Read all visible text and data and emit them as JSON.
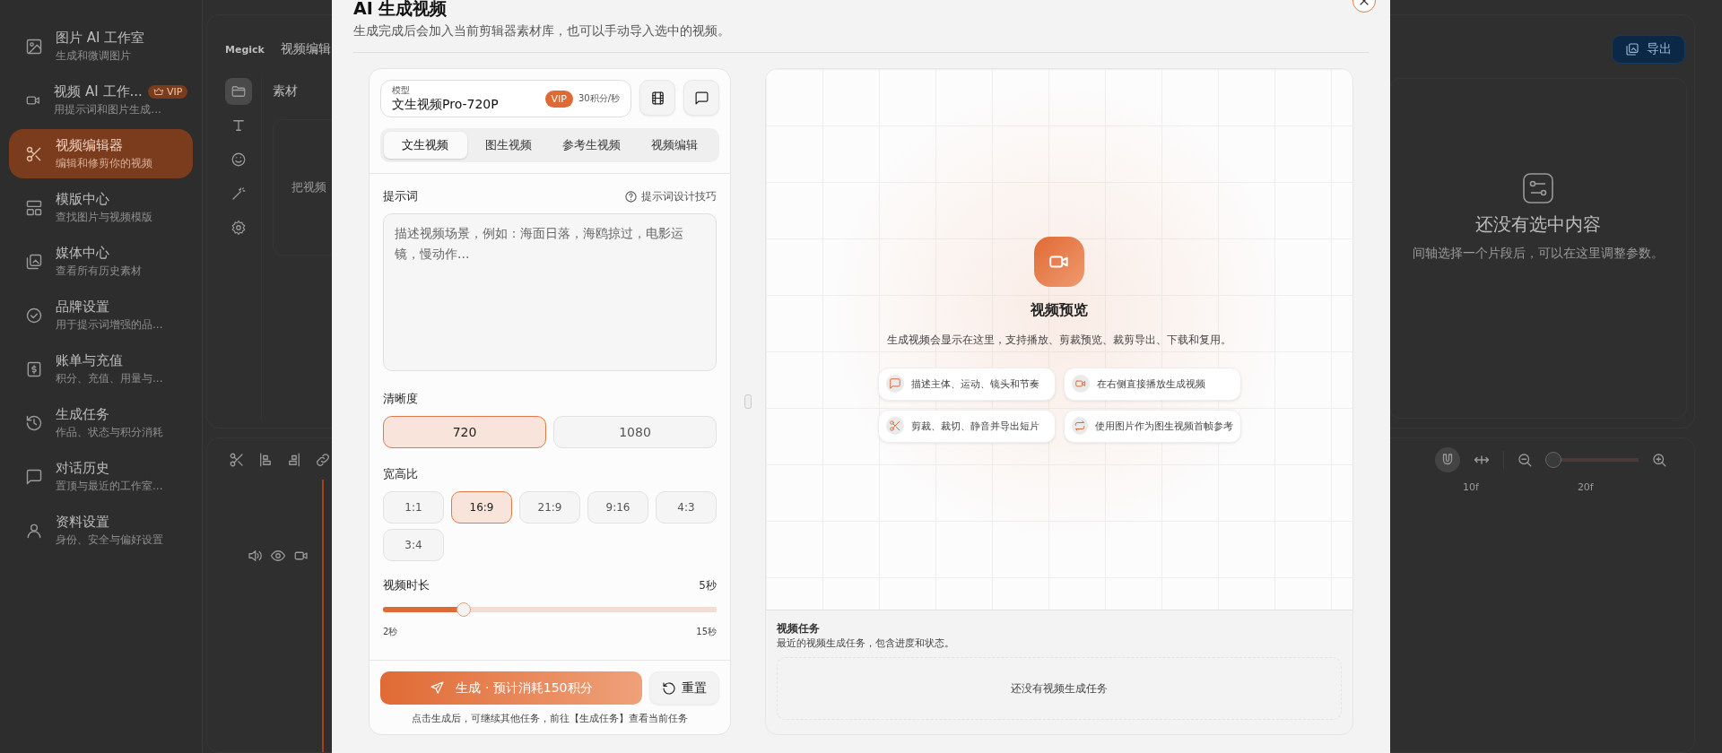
{
  "sidebar": {
    "items": [
      {
        "title": "图片 AI 工作室",
        "subtitle": "生成和微调图片",
        "selected": false
      },
      {
        "title": "视频 AI 工作...",
        "subtitle": "用提示词和图片生成...",
        "selected": false,
        "badge": "VIP"
      },
      {
        "title": "视频编辑器",
        "subtitle": "编辑和修剪你的视频",
        "selected": true
      },
      {
        "title": "模版中心",
        "subtitle": "查找图片与视频模版",
        "selected": false
      },
      {
        "title": "媒体中心",
        "subtitle": "查看所有历史素材",
        "selected": false
      },
      {
        "title": "品牌设置",
        "subtitle": "用于提示词增强的品...",
        "selected": false
      },
      {
        "title": "账单与充值",
        "subtitle": "积分、充值、用量与...",
        "selected": false
      },
      {
        "title": "生成任务",
        "subtitle": "作品、状态与积分消耗",
        "selected": false
      },
      {
        "title": "对话历史",
        "subtitle": "置顶与最近的工作室...",
        "selected": false
      },
      {
        "title": "资料设置",
        "subtitle": "身份、安全与偏好设置",
        "selected": false
      }
    ]
  },
  "editor": {
    "logo": "Megick",
    "title": "视频编辑",
    "export_button": "导出",
    "tool_rail": [
      {
        "kind": "folder",
        "selected": true
      },
      {
        "kind": "text",
        "selected": false
      },
      {
        "kind": "emoji",
        "selected": false
      },
      {
        "kind": "wand",
        "selected": false
      },
      {
        "kind": "gear",
        "selected": false
      }
    ],
    "materials": {
      "title": "素材",
      "drop_hint": "把视频"
    },
    "inspector": {
      "title": "还没有选中内容",
      "hint": "间轴选择一个片段后，可以在这里调整参数。"
    },
    "timeline": {
      "ruler_labels": [
        "10f",
        "20f"
      ],
      "zoom": {
        "level": 0
      }
    }
  },
  "modal": {
    "title": "AI 生成视频",
    "subtitle": "生成完成后会加入当前剪辑器素材库，也可以手动导入选中的视频。",
    "model": {
      "label": "模型",
      "value": "文生视频Pro-720P",
      "badge": "VIP",
      "price": "30积分/秒"
    },
    "tabs": [
      {
        "label": "文生视频",
        "selected": true
      },
      {
        "label": "图生视频",
        "selected": false
      },
      {
        "label": "参考生视频",
        "selected": false
      },
      {
        "label": "视频编辑",
        "selected": false
      }
    ],
    "prompt": {
      "label": "提示词",
      "help_link": "提示词设计技巧",
      "placeholder": "描述视频场景，例如：海面日落，海鸥掠过，电影运镜，慢动作..."
    },
    "resolution": {
      "label": "清晰度",
      "options": [
        {
          "label": "720",
          "selected": true
        },
        {
          "label": "1080",
          "selected": false
        }
      ]
    },
    "aspect_ratio": {
      "label": "宽高比",
      "options": [
        {
          "label": "1:1",
          "selected": false
        },
        {
          "label": "16:9",
          "selected": true
        },
        {
          "label": "21:9",
          "selected": false
        },
        {
          "label": "9:16",
          "selected": false
        },
        {
          "label": "4:3",
          "selected": false
        },
        {
          "label": "3:4",
          "selected": false
        }
      ]
    },
    "duration": {
      "label": "视频时长",
      "value": "5秒",
      "level": 0.23,
      "min_label": "2秒",
      "max_label": "15秒"
    },
    "generate_button": "生成 · 预计消耗150积分",
    "reset_button": "重置",
    "footnote": "点击生成后，可继续其他任务，前往【生成任务】查看当前任务",
    "preview": {
      "title": "视频预览",
      "description": "生成视频会显示在这里，支持播放、剪裁预览、裁剪导出、下载和复用。",
      "tips": [
        {
          "kind": "chat",
          "text": "描述主体、运动、镜头和节奏"
        },
        {
          "kind": "video",
          "text": "在右侧直接播放生成视频"
        },
        {
          "kind": "scissors",
          "text": "剪裁、裁切、静音并导出短片"
        },
        {
          "kind": "repeat",
          "text": "使用图片作为图生视频首帧参考"
        }
      ]
    },
    "tasks": {
      "title": "视频任务",
      "subtitle": "最近的视频生成任务，包含进度和状态。",
      "empty": "还没有视频生成任务"
    }
  }
}
